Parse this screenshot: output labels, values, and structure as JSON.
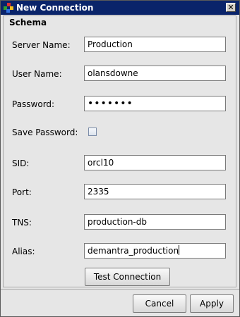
{
  "window": {
    "title": "New Connection",
    "close_label": "✕",
    "app_icon": "colored-blocks-icon"
  },
  "schema": {
    "group_title": "Schema",
    "fields": {
      "server_name": {
        "label": "Server Name:",
        "value": "Production"
      },
      "user_name": {
        "label": "User Name:",
        "value": "olansdowne"
      },
      "password": {
        "label": "Password:",
        "value": "•••••••"
      },
      "save_password": {
        "label": "Save Password:",
        "checked": false
      },
      "sid": {
        "label": "SID:",
        "value": "orcl10"
      },
      "port": {
        "label": "Port:",
        "value": "2335"
      },
      "tns": {
        "label": "TNS:",
        "value": "production-db"
      },
      "alias": {
        "label": "Alias:",
        "value": "demantra_production"
      }
    },
    "test_button": "Test Connection"
  },
  "footer": {
    "cancel_label": "Cancel",
    "apply_label": "Apply"
  }
}
